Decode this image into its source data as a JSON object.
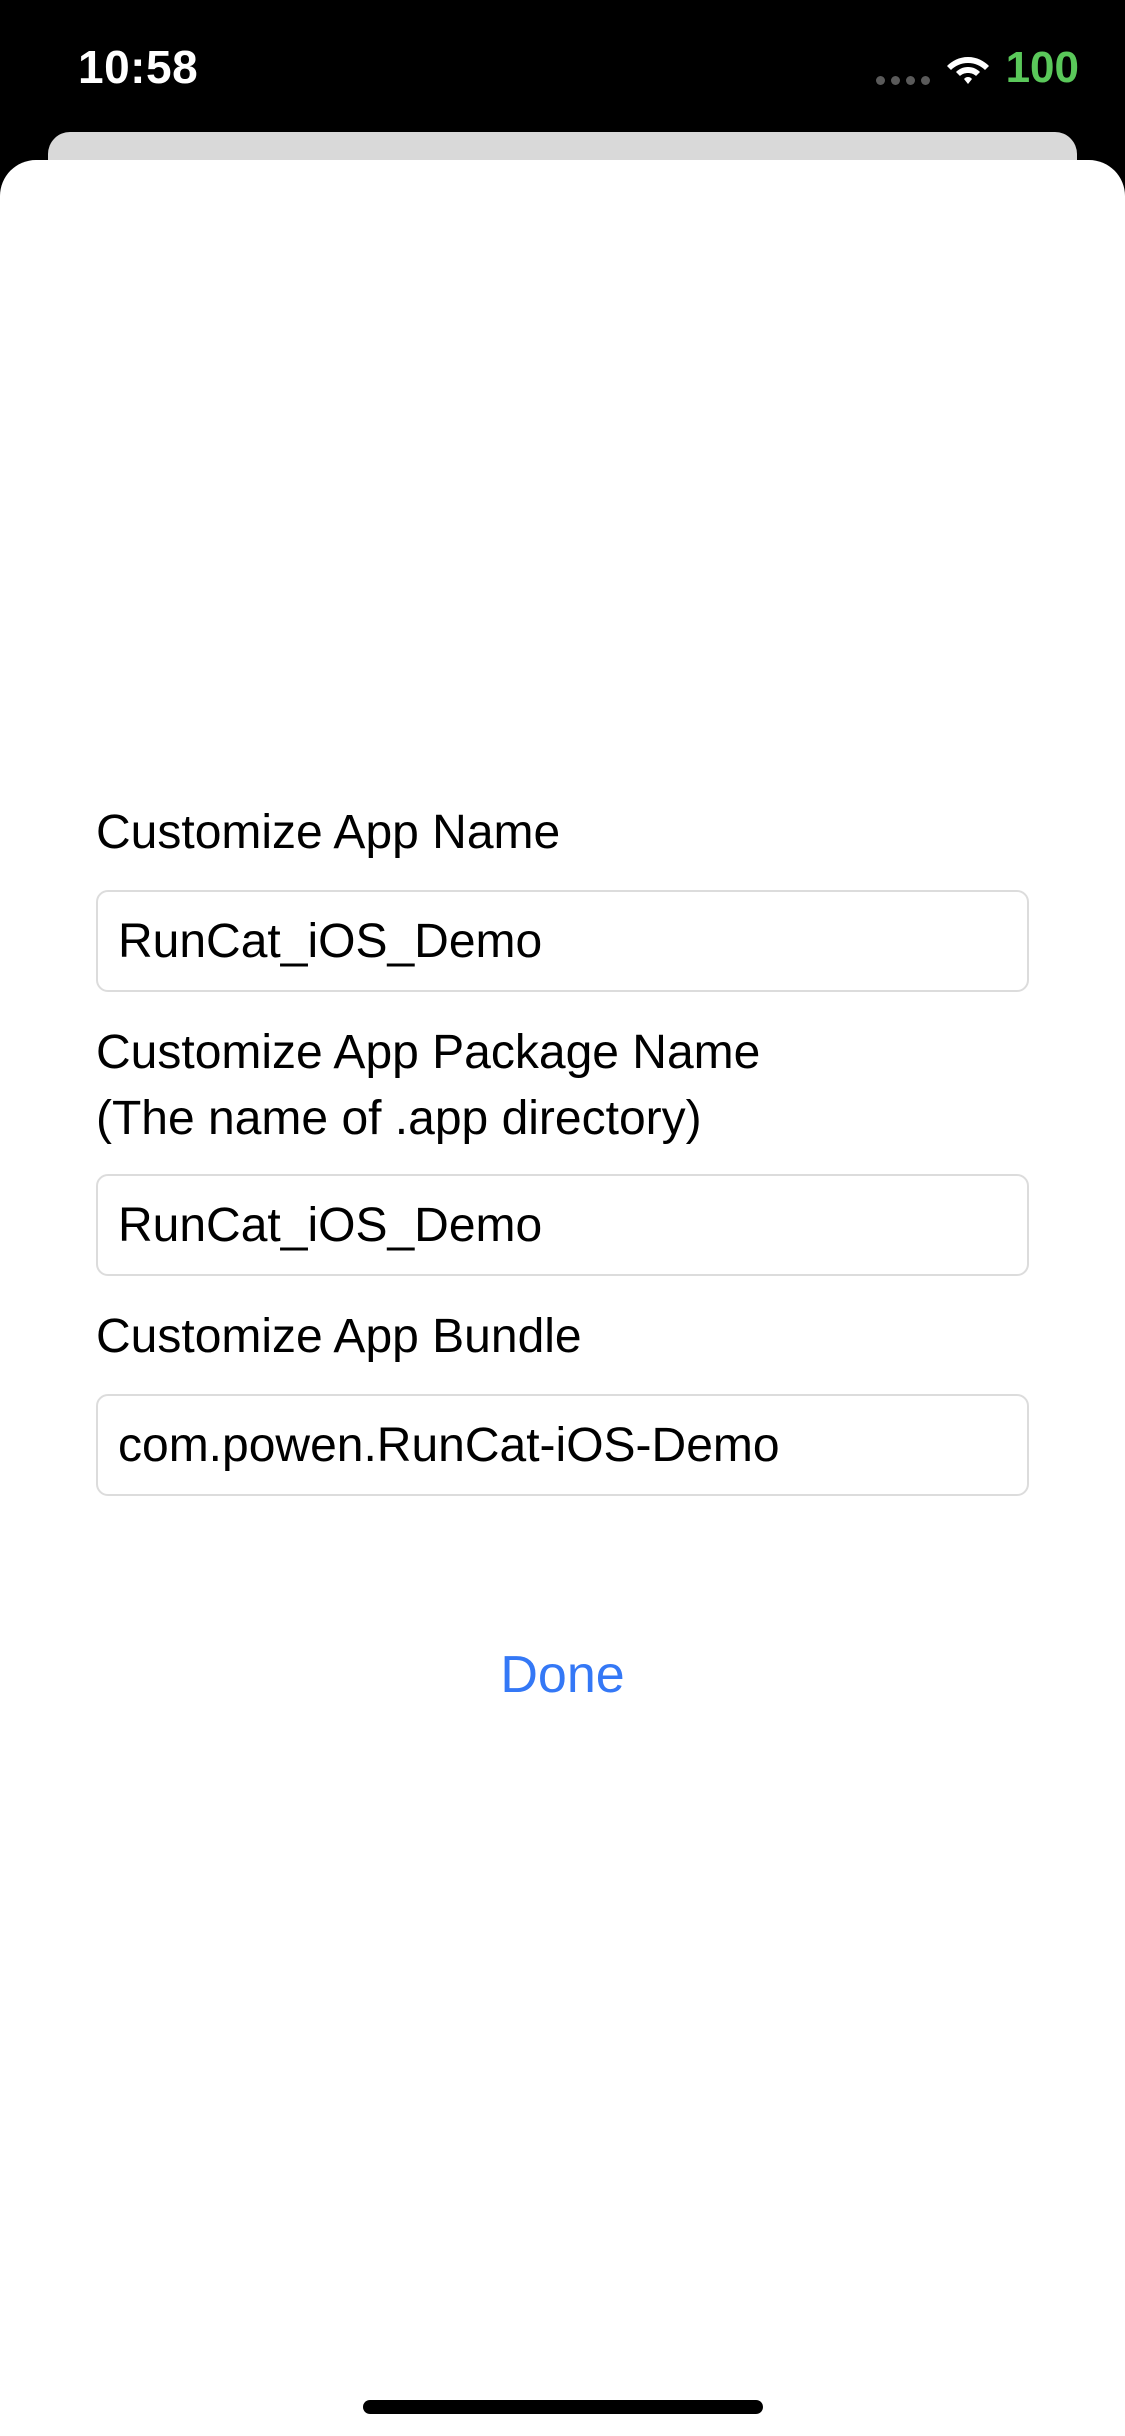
{
  "status_bar": {
    "time": "10:58",
    "battery": "100",
    "wifi_icon": "wifi-icon",
    "signal_icon": "cellular-signal-icon",
    "battery_color": "#5ac85a"
  },
  "form": {
    "app_name": {
      "label": "Customize App Name",
      "value": "RunCat_iOS_Demo"
    },
    "package_name": {
      "label": "Customize App Package Name",
      "sublabel": "(The name of .app directory)",
      "value": "RunCat_iOS_Demo"
    },
    "bundle": {
      "label": "Customize App Bundle",
      "value": "com.powen.RunCat-iOS-Demo"
    }
  },
  "done_button": {
    "label": "Done",
    "color": "#3478f6"
  }
}
